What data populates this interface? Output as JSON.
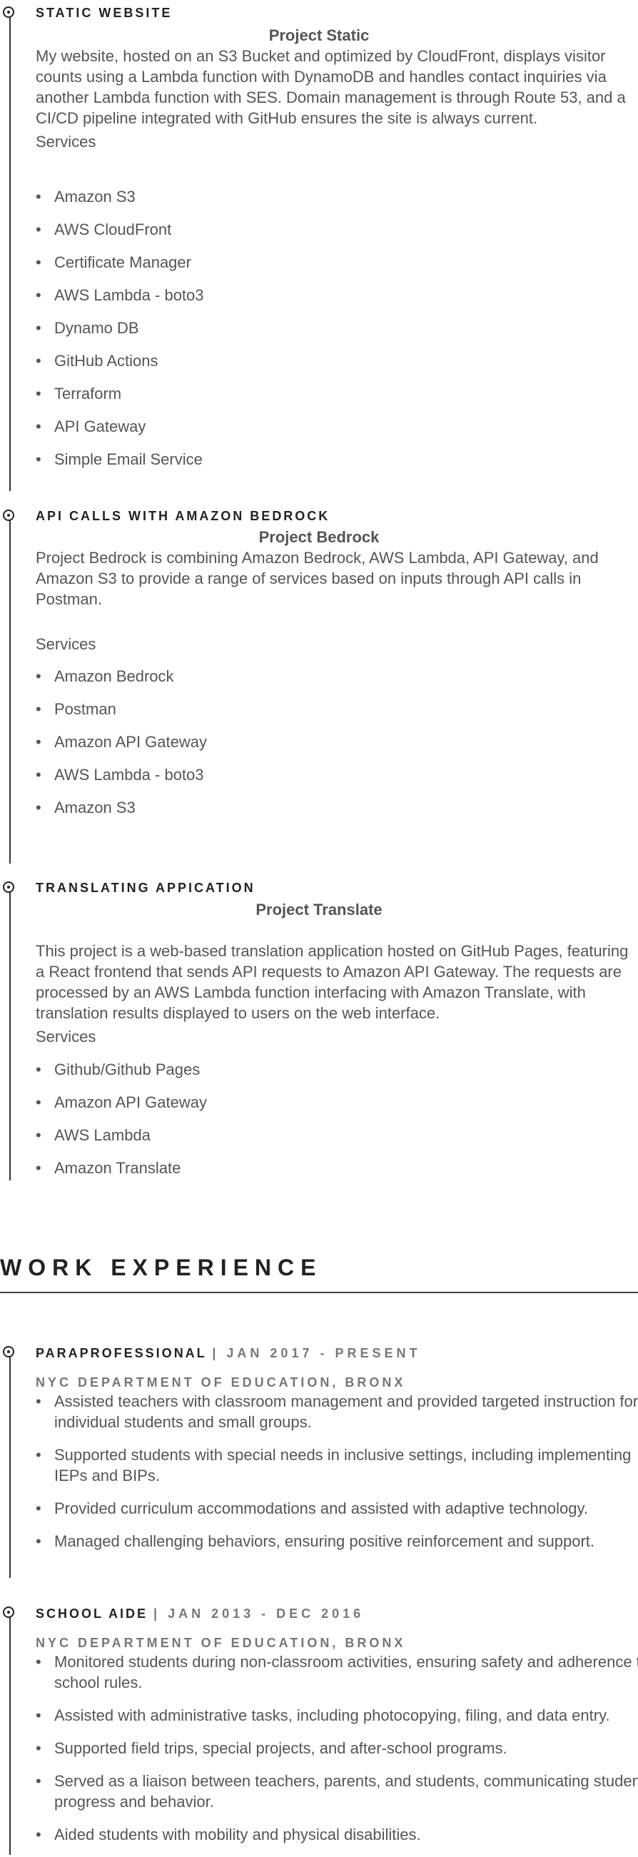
{
  "projects": [
    {
      "title": "STATIC WEBSITE",
      "name": "Project Static",
      "description": "My website, hosted on an S3 Bucket and optimized by CloudFront, displays visitor counts using a Lambda function with DynamoDB and handles contact inquiries via another Lambda function with SES. Domain management is through Route 53, and a CI/CD pipeline integrated with GitHub ensures the site is always current.",
      "services_label": "Services",
      "services": [
        "Amazon S3",
        "AWS CloudFront",
        "Certificate Manager",
        "AWS Lambda - boto3",
        "Dynamo DB",
        "GitHub Actions",
        "Terraform",
        "API Gateway",
        "Simple Email Service"
      ]
    },
    {
      "title": "API CALLS WITH AMAZON BEDROCK",
      "name": "Project Bedrock",
      "description": "Project Bedrock is combining Amazon Bedrock, AWS Lambda, API Gateway, and Amazon S3 to provide a range of services based on inputs through API calls in Postman.",
      "services_label": "Services",
      "services": [
        "Amazon Bedrock",
        "Postman",
        "Amazon API Gateway",
        "AWS Lambda - boto3",
        "Amazon S3"
      ]
    },
    {
      "title": "TRANSLATING APPICATION",
      "name": "Project Translate",
      "description": "This project is a web-based translation application hosted on GitHub Pages, featuring a React frontend that sends API requests to Amazon API Gateway. The requests are processed by an AWS Lambda function interfacing with Amazon Translate, with translation results displayed to users on the web interface.",
      "services_label": "Services",
      "services": [
        "Github/Github Pages",
        "Amazon API Gateway",
        "AWS Lambda",
        "Amazon Translate"
      ]
    }
  ],
  "work_experience": {
    "heading": "WORK EXPERIENCE",
    "jobs": [
      {
        "role": "PARAPROFESSIONAL",
        "date": "| JAN 2017 - PRESENT",
        "org": "NYC DEPARTMENT OF EDUCATION, BRONX",
        "duties": [
          "Assisted teachers with classroom management and provided targeted instruction for individual students and small groups.",
          "Supported students with special needs in inclusive settings, including implementing IEPs and BIPs.",
          "Provided curriculum accommodations and assisted with adaptive technology.",
          "Managed challenging behaviors, ensuring positive reinforcement and support."
        ]
      },
      {
        "role": "SCHOOL AIDE",
        "date": "| JAN 2013 - DEC 2016",
        "org": "NYC DEPARTMENT OF EDUCATION, BRONX",
        "duties": [
          "Monitored students during non-classroom activities, ensuring safety and adherence to school rules.",
          "Assisted with administrative tasks, including photocopying, filing, and data entry.",
          "Supported field trips, special projects, and after-school programs.",
          "Served as a liaison between teachers, parents, and students, communicating student progress and behavior.",
          "Aided students with mobility and physical disabilities."
        ]
      }
    ]
  }
}
